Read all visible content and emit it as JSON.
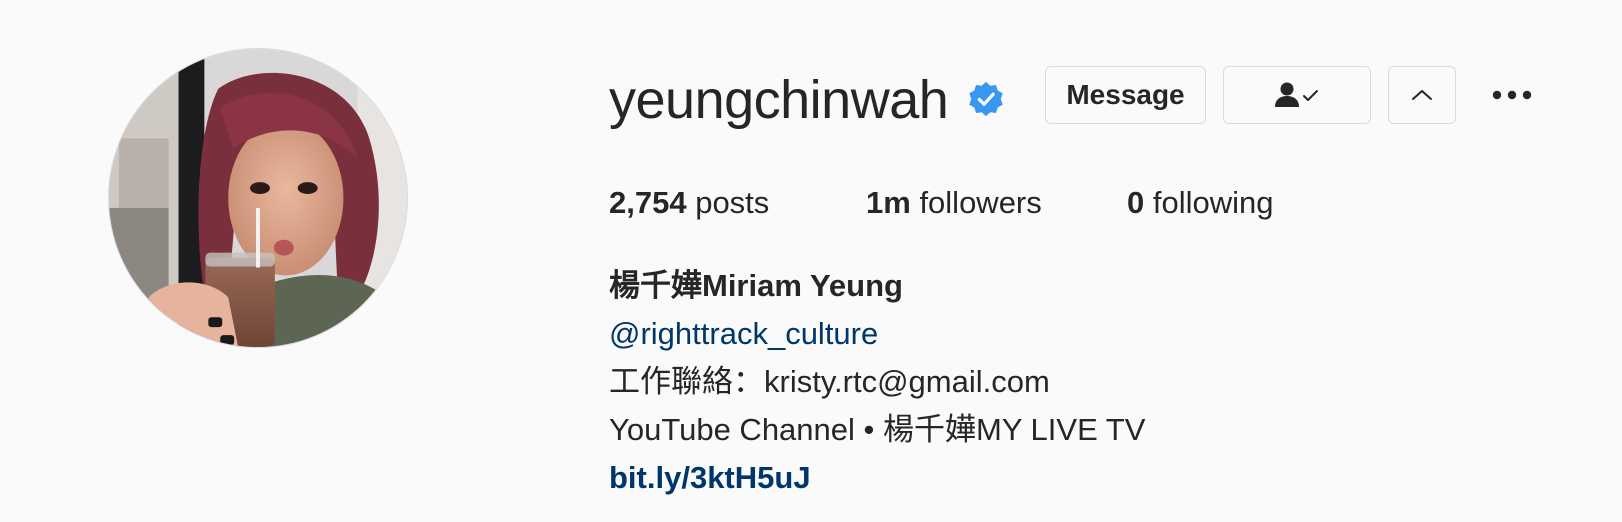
{
  "profile": {
    "username": "yeungchinwah",
    "verified_icon": "verified-badge-icon",
    "accent_color": "#3897f0"
  },
  "actions": {
    "message_label": "Message",
    "following_icon": "person-check-icon",
    "suggested_icon": "chevron-up-icon",
    "more_icon": "more-options-icon"
  },
  "stats": {
    "posts_count": "2,754",
    "posts_label": "posts",
    "followers_count": "1m",
    "followers_label": "followers",
    "following_count": "0",
    "following_label": "following"
  },
  "bio": {
    "full_name": "楊千嬅Miriam Yeung",
    "mention": "@righttrack_culture",
    "line_contact": "工作聯絡：kristy.rtc@gmail.com",
    "line_youtube": "YouTube Channel • 楊千嬅MY LIVE TV",
    "link": "bit.ly/3ktH5uJ",
    "link_color": "#00376b"
  }
}
